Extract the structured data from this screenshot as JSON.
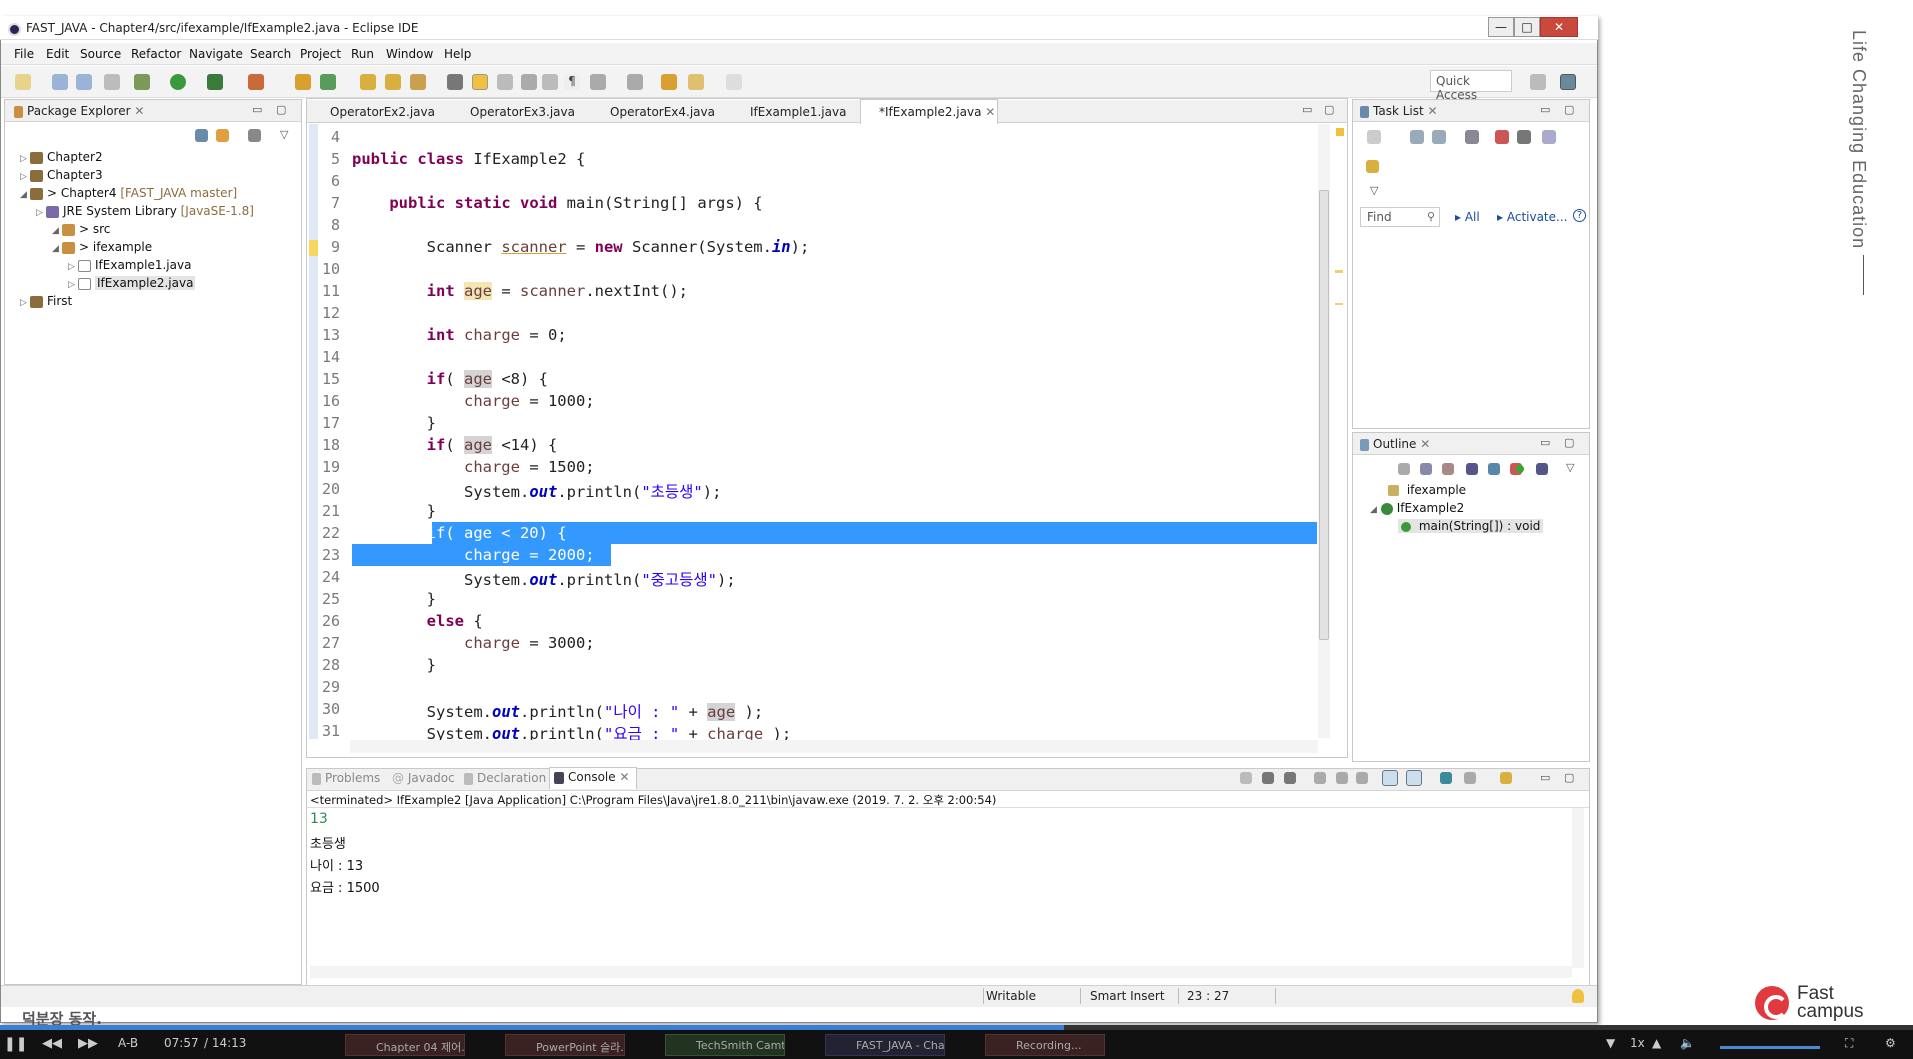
{
  "window": {
    "title": "FAST_JAVA - Chapter4/src/ifexample/IfExample2.java - Eclipse IDE",
    "buttons": [
      "—",
      "□",
      "✕"
    ]
  },
  "menu": [
    "File",
    "Edit",
    "Source",
    "Refactor",
    "Navigate",
    "Search",
    "Project",
    "Run",
    "Window",
    "Help"
  ],
  "quick_access": "Quick Access",
  "package_explorer": {
    "title": "Package Explorer",
    "items": [
      {
        "label": "Chapter2",
        "decor": ""
      },
      {
        "label": "Chapter3",
        "decor": ""
      },
      {
        "label": "> Chapter4",
        "decor": "[FAST_JAVA master]"
      },
      {
        "label": "JRE System Library",
        "decor": "[JavaSE-1.8]"
      },
      {
        "label": "> src",
        "decor": ""
      },
      {
        "label": "> ifexample",
        "decor": ""
      },
      {
        "label": "IfExample1.java",
        "decor": ""
      },
      {
        "label": "IfExample2.java",
        "decor": ""
      },
      {
        "label": "First",
        "decor": ""
      }
    ]
  },
  "editor": {
    "tabs": [
      "OperatorEx2.java",
      "OperatorEx3.java",
      "OperatorEx4.java",
      "IfExample1.java",
      "*IfExample2.java"
    ],
    "active_tab": 4,
    "line_numbers": [
      "4",
      "5",
      "6",
      "7",
      "8",
      "9",
      "10",
      "11",
      "12",
      "13",
      "14",
      "15",
      "16",
      "17",
      "18",
      "19",
      "20",
      "21",
      "22",
      "23",
      "24",
      "25",
      "26",
      "27",
      "28",
      "29",
      "30",
      "31"
    ]
  },
  "task_list": {
    "title": "Task List",
    "find_placeholder": "Find",
    "all": "All",
    "activate": "Activate..."
  },
  "outline": {
    "title": "Outline",
    "items": [
      "ifexample",
      "IfExample2",
      "main(String[]) : void"
    ]
  },
  "console": {
    "tabs": [
      "Problems",
      "Javadoc",
      "Declaration",
      "Console"
    ],
    "header": "<terminated> IfExample2 [Java Application] C:\\Program Files\\Java\\jre1.8.0_211\\bin\\javaw.exe (2019. 7. 2. 오후 2:00:54)",
    "lines": [
      "13",
      "초등생",
      "나이 : 13",
      "요금 : 1500"
    ]
  },
  "status": {
    "mode": "Writable",
    "insert": "Smart Insert",
    "position": "23 : 27"
  },
  "overlay": {
    "side_text": "Life Changing Education",
    "logo_line1": "Fast",
    "logo_line2": "campus",
    "subtitle": "덕분장 동작.",
    "time": "07:57",
    "duration": "/ 14:13",
    "ab": "A-B",
    "speed": "1x",
    "progress": 0.556,
    "tasks": [
      "Chapter 04 제어...",
      "PowerPoint 슬라...",
      "TechSmith Camt...",
      "FAST_JAVA - Cha...",
      "Recording..."
    ]
  }
}
